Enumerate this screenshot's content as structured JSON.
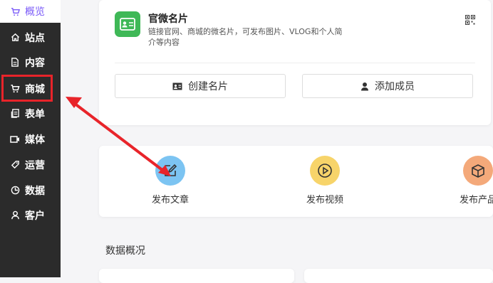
{
  "sidebar": {
    "items": [
      {
        "label": "概览",
        "icon": "cart-outline-icon"
      },
      {
        "label": "站点",
        "icon": "home-icon"
      },
      {
        "label": "内容",
        "icon": "document-icon"
      },
      {
        "label": "商城",
        "icon": "cart-icon"
      },
      {
        "label": "表单",
        "icon": "form-icon"
      },
      {
        "label": "媒体",
        "icon": "video-icon"
      },
      {
        "label": "运营",
        "icon": "tag-icon"
      },
      {
        "label": "数据",
        "icon": "pie-chart-icon"
      },
      {
        "label": "客户",
        "icon": "user-icon"
      }
    ],
    "active_index": 0,
    "highlighted_index": 3
  },
  "namecard": {
    "title": "官微名片",
    "description": "链接官网、商城的微名片，可发布图片、VLOG和个人简介等内容",
    "create_button": "创建名片",
    "add_member_button": "添加成员"
  },
  "quick_actions": [
    {
      "label": "发布文章",
      "color": "#7cc4f2",
      "icon": "edit-icon"
    },
    {
      "label": "发布视频",
      "color": "#f7d46a",
      "icon": "play-icon"
    },
    {
      "label": "发布产品",
      "color": "#f4a97a",
      "icon": "box-icon"
    }
  ],
  "data_overview": {
    "title": "数据概况"
  },
  "colors": {
    "sidebar_bg": "#2b2b2b",
    "accent": "#7a5af8",
    "annotation_red": "#e8242a",
    "brand_green": "#3fb857"
  }
}
